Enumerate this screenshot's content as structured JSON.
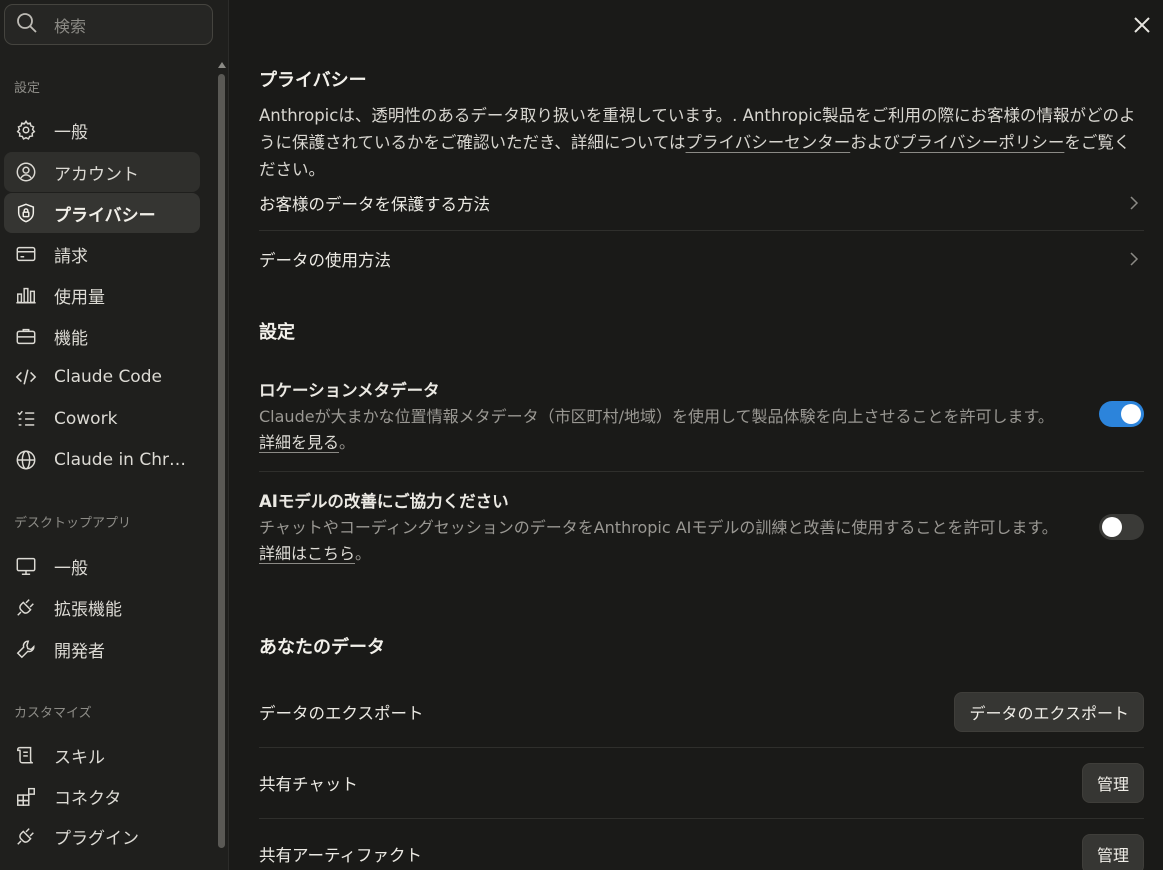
{
  "search": {
    "placeholder": "検索"
  },
  "sidebar": {
    "section_settings": "設定",
    "settings_items": [
      {
        "label": "一般",
        "icon": "gear-icon"
      },
      {
        "label": "アカウント",
        "icon": "user-circle-icon"
      },
      {
        "label": "プライバシー",
        "icon": "shield-lock-icon"
      },
      {
        "label": "請求",
        "icon": "credit-card-icon"
      },
      {
        "label": "使用量",
        "icon": "bar-chart-icon"
      },
      {
        "label": "機能",
        "icon": "briefcase-icon"
      },
      {
        "label": "Claude Code",
        "icon": "code-icon"
      },
      {
        "label": "Cowork",
        "icon": "checklist-icon"
      },
      {
        "label": "Claude in Chr…",
        "icon": "globe-icon"
      }
    ],
    "section_desktop": "デスクトップアプリ",
    "desktop_items": [
      {
        "label": "一般",
        "icon": "monitor-icon"
      },
      {
        "label": "拡張機能",
        "icon": "plug-icon"
      },
      {
        "label": "開発者",
        "icon": "wrench-icon"
      }
    ],
    "section_customize": "カスタマイズ",
    "customize_items": [
      {
        "label": "スキル",
        "icon": "scroll-icon"
      },
      {
        "label": "コネクタ",
        "icon": "grid-plus-icon"
      },
      {
        "label": "プラグイン",
        "icon": "plug-icon"
      }
    ]
  },
  "main": {
    "privacy_heading": "プライバシー",
    "privacy_desc_1": "Anthropicは、透明性のあるデータ取り扱いを重視しています。. Anthropic製品をご利用の際にお客様の情報がどのように保護されているかをご確認いただき、詳細については",
    "privacy_center_link": "プライバシーセンター",
    "privacy_desc_2": "および",
    "privacy_policy_link": "プライバシーポリシー",
    "privacy_desc_3": "をご覧ください。",
    "row_protect": "お客様のデータを保護する方法",
    "row_usage": "データの使用方法",
    "settings_heading": "設定",
    "location_title": "ロケーションメタデータ",
    "location_desc": "Claudeが大まかな位置情報メタデータ（市区町村/地域）を使用して製品体験を向上させることを許可します。",
    "location_link": "詳細を見る",
    "location_end": "。",
    "location_toggle_on": true,
    "model_title": "AIモデルの改善にご協力ください",
    "model_desc": "チャットやコーディングセッションのデータをAnthropic AIモデルの訓練と改善に使用することを許可します。",
    "model_link": "詳細はこちら",
    "model_end": "。",
    "model_toggle_on": false,
    "your_data_heading": "あなたのデータ",
    "export_label": "データのエクスポート",
    "export_button": "データのエクスポート",
    "shared_chats_label": "共有チャット",
    "shared_chats_button": "管理",
    "shared_artifacts_label": "共有アーティファクト",
    "shared_artifacts_button": "管理"
  },
  "colors": {
    "toggle_on": "#2c84db",
    "background": "#1a1a18",
    "sidebar": "#1f1f1d"
  }
}
